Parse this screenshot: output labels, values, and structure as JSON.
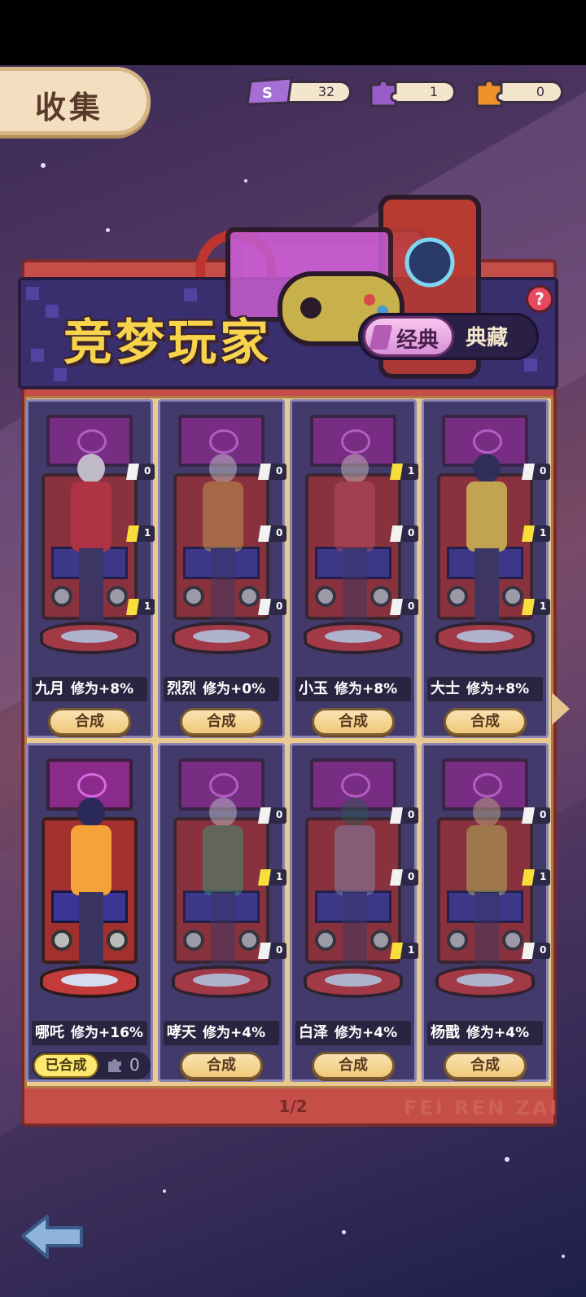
{
  "header": {
    "title": "收集"
  },
  "currencies": [
    {
      "icon": "ticket-icon",
      "value": "32",
      "color": "#a66fd6"
    },
    {
      "icon": "purple-puzzle-icon",
      "value": "1",
      "color": "#9a5cc8"
    },
    {
      "icon": "orange-puzzle-icon",
      "value": "0",
      "color": "#f0922a"
    }
  ],
  "banner": {
    "title": "竞梦玩家",
    "tabs": [
      {
        "label": "经典",
        "active": true
      },
      {
        "label": "典藏",
        "active": false
      }
    ],
    "help": "?"
  },
  "cards": [
    {
      "name": "九月",
      "bonus": "修为+8%",
      "pieces": [
        "0",
        "1",
        "1"
      ],
      "action": "合成",
      "owned": false
    },
    {
      "name": "烈烈",
      "bonus": "修为+0%",
      "pieces": [
        "0",
        "0",
        "0"
      ],
      "action": "合成",
      "owned": false
    },
    {
      "name": "小玉",
      "bonus": "修为+8%",
      "pieces": [
        "1",
        "0",
        "0"
      ],
      "action": "合成",
      "owned": false
    },
    {
      "name": "大士",
      "bonus": "修为+8%",
      "pieces": [
        "0",
        "1",
        "1"
      ],
      "action": "合成",
      "owned": false
    },
    {
      "name": "哪吒",
      "bonus": "修为+16%",
      "pieces": [],
      "action": "已合成",
      "owned": true,
      "spare": "0"
    },
    {
      "name": "哮天",
      "bonus": "修为+4%",
      "pieces": [
        "0",
        "1",
        "0"
      ],
      "action": "合成",
      "owned": false
    },
    {
      "name": "白泽",
      "bonus": "修为+4%",
      "pieces": [
        "0",
        "0",
        "1"
      ],
      "action": "合成",
      "owned": false
    },
    {
      "name": "杨戬",
      "bonus": "修为+4%",
      "pieces": [
        "0",
        "1",
        "0"
      ],
      "action": "合成",
      "owned": false
    }
  ],
  "pagination": {
    "label": "1/2"
  },
  "watermark": "FEI REN ZAI",
  "colors": {
    "accent": "#f7d44b",
    "panel": "#c54f48",
    "card": "#413a6a"
  }
}
